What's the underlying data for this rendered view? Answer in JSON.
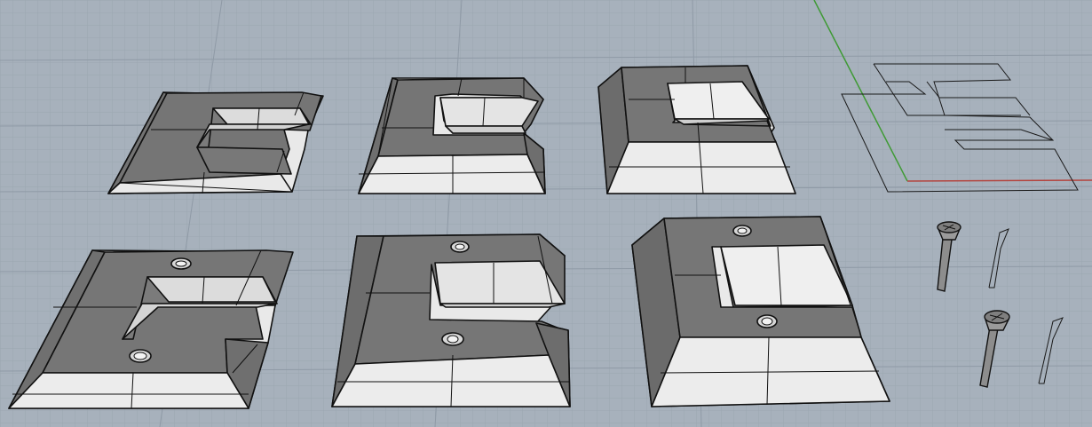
{
  "viewport": {
    "label": "",
    "background": "#a7b1bc",
    "grid_minor_color": "#9ba6b1",
    "grid_major_color": "#8f9aa6",
    "x_axis_color": "#b4443e",
    "y_axis_color": "#3f9a35"
  },
  "materials": {
    "edge_color": "#111111",
    "dark_face": "#6f6f6f",
    "mid_face": "#7a7a7a",
    "light_face": "#e9e9e9",
    "inner_face": "#d9d9d9",
    "hole_fill": "#d7d7d7"
  },
  "objects": [
    {
      "id": "c-bracket-flat-top-left",
      "kind": "c-bracket"
    },
    {
      "id": "c-bracket-raised-top-mid",
      "kind": "c-bracket"
    },
    {
      "id": "c-bracket-tall-top-right",
      "kind": "c-bracket"
    },
    {
      "id": "c-bracket-flat-bottom-left",
      "kind": "c-bracket-with-holes"
    },
    {
      "id": "c-bracket-raised-bottom-mid",
      "kind": "c-bracket-with-holes"
    },
    {
      "id": "c-bracket-tall-bottom-right",
      "kind": "c-bracket-with-holes"
    },
    {
      "id": "wire-outline",
      "kind": "curves"
    },
    {
      "id": "screw-1",
      "kind": "countersunk-screw"
    },
    {
      "id": "screw-2",
      "kind": "countersunk-screw"
    },
    {
      "id": "profile-1",
      "kind": "screw-profile-curve"
    },
    {
      "id": "profile-2",
      "kind": "screw-profile-curve"
    }
  ]
}
